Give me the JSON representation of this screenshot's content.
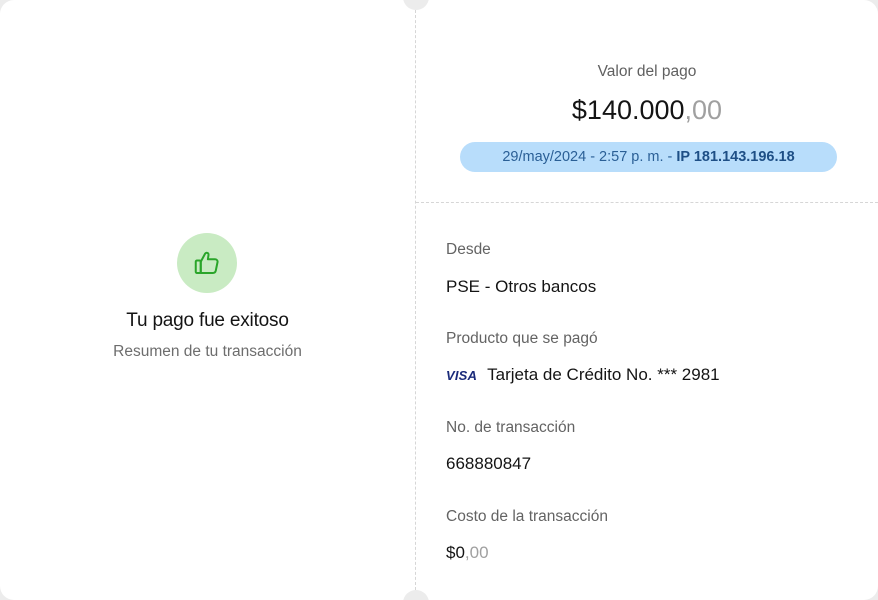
{
  "success": {
    "icon": "thumbs-up-icon",
    "title": "Tu pago fue exitoso",
    "subtitle": "Resumen de tu transacción"
  },
  "payment": {
    "label": "Valor del pago",
    "amount_main": "$140.000",
    "amount_cents": ",00",
    "date_text": "29/may/2024 - 2:57 p. m. -",
    "ip_text": "IP 181.143.196.18"
  },
  "details": {
    "from_label": "Desde",
    "from_value": "PSE - Otros bancos",
    "product_label": "Producto que se pagó",
    "card_brand": "VISA",
    "product_value": "Tarjeta de Crédito No. *** 2981",
    "txn_label": "No. de transacción",
    "txn_value": "668880847",
    "cost_label": "Costo de la transacción",
    "cost_main": "$0",
    "cost_cents": ",00"
  },
  "colors": {
    "success_circle": "#c9ebc3",
    "success_icon": "#2aa52a",
    "pill_bg": "#b8ddfb",
    "pill_text": "#2a5f96"
  }
}
